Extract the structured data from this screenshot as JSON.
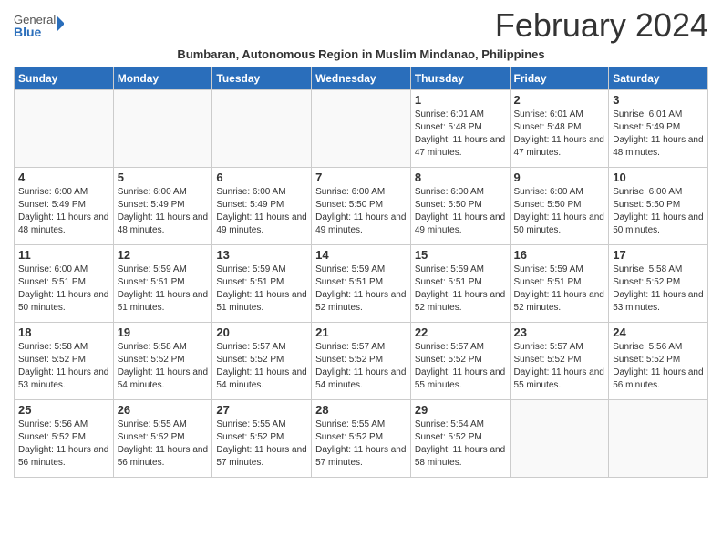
{
  "header": {
    "logo_general": "General",
    "logo_blue": "Blue",
    "month_title": "February 2024",
    "subtitle": "Bumbaran, Autonomous Region in Muslim Mindanao, Philippines"
  },
  "weekdays": [
    "Sunday",
    "Monday",
    "Tuesday",
    "Wednesday",
    "Thursday",
    "Friday",
    "Saturday"
  ],
  "weeks": [
    [
      {
        "day": "",
        "info": ""
      },
      {
        "day": "",
        "info": ""
      },
      {
        "day": "",
        "info": ""
      },
      {
        "day": "",
        "info": ""
      },
      {
        "day": "1",
        "info": "Sunrise: 6:01 AM\nSunset: 5:48 PM\nDaylight: 11 hours and 47 minutes."
      },
      {
        "day": "2",
        "info": "Sunrise: 6:01 AM\nSunset: 5:48 PM\nDaylight: 11 hours and 47 minutes."
      },
      {
        "day": "3",
        "info": "Sunrise: 6:01 AM\nSunset: 5:49 PM\nDaylight: 11 hours and 48 minutes."
      }
    ],
    [
      {
        "day": "4",
        "info": "Sunrise: 6:00 AM\nSunset: 5:49 PM\nDaylight: 11 hours and 48 minutes."
      },
      {
        "day": "5",
        "info": "Sunrise: 6:00 AM\nSunset: 5:49 PM\nDaylight: 11 hours and 48 minutes."
      },
      {
        "day": "6",
        "info": "Sunrise: 6:00 AM\nSunset: 5:49 PM\nDaylight: 11 hours and 49 minutes."
      },
      {
        "day": "7",
        "info": "Sunrise: 6:00 AM\nSunset: 5:50 PM\nDaylight: 11 hours and 49 minutes."
      },
      {
        "day": "8",
        "info": "Sunrise: 6:00 AM\nSunset: 5:50 PM\nDaylight: 11 hours and 49 minutes."
      },
      {
        "day": "9",
        "info": "Sunrise: 6:00 AM\nSunset: 5:50 PM\nDaylight: 11 hours and 50 minutes."
      },
      {
        "day": "10",
        "info": "Sunrise: 6:00 AM\nSunset: 5:50 PM\nDaylight: 11 hours and 50 minutes."
      }
    ],
    [
      {
        "day": "11",
        "info": "Sunrise: 6:00 AM\nSunset: 5:51 PM\nDaylight: 11 hours and 50 minutes."
      },
      {
        "day": "12",
        "info": "Sunrise: 5:59 AM\nSunset: 5:51 PM\nDaylight: 11 hours and 51 minutes."
      },
      {
        "day": "13",
        "info": "Sunrise: 5:59 AM\nSunset: 5:51 PM\nDaylight: 11 hours and 51 minutes."
      },
      {
        "day": "14",
        "info": "Sunrise: 5:59 AM\nSunset: 5:51 PM\nDaylight: 11 hours and 52 minutes."
      },
      {
        "day": "15",
        "info": "Sunrise: 5:59 AM\nSunset: 5:51 PM\nDaylight: 11 hours and 52 minutes."
      },
      {
        "day": "16",
        "info": "Sunrise: 5:59 AM\nSunset: 5:51 PM\nDaylight: 11 hours and 52 minutes."
      },
      {
        "day": "17",
        "info": "Sunrise: 5:58 AM\nSunset: 5:52 PM\nDaylight: 11 hours and 53 minutes."
      }
    ],
    [
      {
        "day": "18",
        "info": "Sunrise: 5:58 AM\nSunset: 5:52 PM\nDaylight: 11 hours and 53 minutes."
      },
      {
        "day": "19",
        "info": "Sunrise: 5:58 AM\nSunset: 5:52 PM\nDaylight: 11 hours and 54 minutes."
      },
      {
        "day": "20",
        "info": "Sunrise: 5:57 AM\nSunset: 5:52 PM\nDaylight: 11 hours and 54 minutes."
      },
      {
        "day": "21",
        "info": "Sunrise: 5:57 AM\nSunset: 5:52 PM\nDaylight: 11 hours and 54 minutes."
      },
      {
        "day": "22",
        "info": "Sunrise: 5:57 AM\nSunset: 5:52 PM\nDaylight: 11 hours and 55 minutes."
      },
      {
        "day": "23",
        "info": "Sunrise: 5:57 AM\nSunset: 5:52 PM\nDaylight: 11 hours and 55 minutes."
      },
      {
        "day": "24",
        "info": "Sunrise: 5:56 AM\nSunset: 5:52 PM\nDaylight: 11 hours and 56 minutes."
      }
    ],
    [
      {
        "day": "25",
        "info": "Sunrise: 5:56 AM\nSunset: 5:52 PM\nDaylight: 11 hours and 56 minutes."
      },
      {
        "day": "26",
        "info": "Sunrise: 5:55 AM\nSunset: 5:52 PM\nDaylight: 11 hours and 56 minutes."
      },
      {
        "day": "27",
        "info": "Sunrise: 5:55 AM\nSunset: 5:52 PM\nDaylight: 11 hours and 57 minutes."
      },
      {
        "day": "28",
        "info": "Sunrise: 5:55 AM\nSunset: 5:52 PM\nDaylight: 11 hours and 57 minutes."
      },
      {
        "day": "29",
        "info": "Sunrise: 5:54 AM\nSunset: 5:52 PM\nDaylight: 11 hours and 58 minutes."
      },
      {
        "day": "",
        "info": ""
      },
      {
        "day": "",
        "info": ""
      }
    ]
  ]
}
